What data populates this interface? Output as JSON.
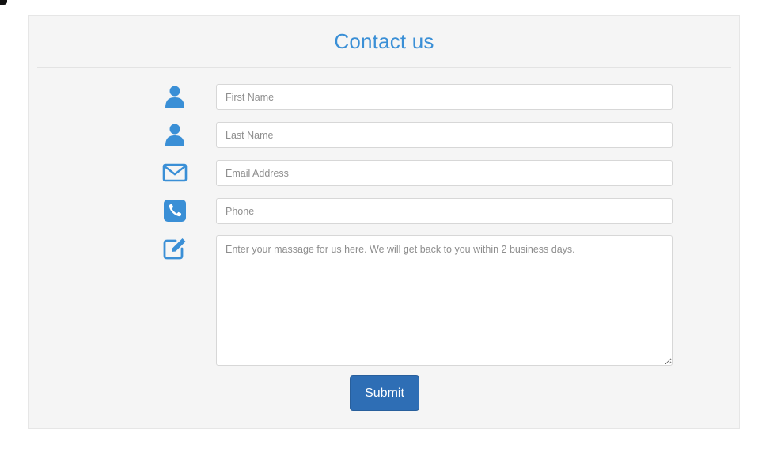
{
  "form": {
    "title": "Contact us",
    "fields": {
      "first_name": {
        "placeholder": "First Name",
        "icon": "user-icon"
      },
      "last_name": {
        "placeholder": "Last Name",
        "icon": "user-icon"
      },
      "email": {
        "placeholder": "Email Address",
        "icon": "envelope-icon"
      },
      "phone": {
        "placeholder": "Phone",
        "icon": "phone-icon"
      },
      "message": {
        "placeholder": "Enter your massage for us here. We will get back to you within 2 business days.",
        "icon": "pencil-square-icon"
      }
    },
    "submit_label": "Submit"
  },
  "colors": {
    "accent": "#3a8fd6",
    "button": "#2e6eb5",
    "panel": "#f5f5f5"
  }
}
